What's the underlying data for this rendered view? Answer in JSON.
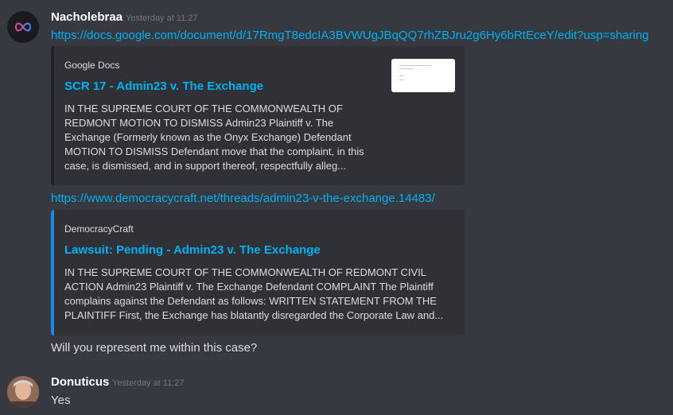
{
  "messages": [
    {
      "username": "Nacholebraa",
      "timestamp": "Yesterday at 11:27",
      "link1": "https://docs.google.com/document/d/17RmgT8edcIA3BVWUgJBqQQ7rhZBJru2g6Hy6bRtEceY/edit?usp=sharing",
      "embed1": {
        "provider": "Google Docs",
        "title": "SCR 17  - Admin23 v. The Exchange",
        "desc_lines": [
          "IN THE SUPREME COURT OF THE COMMONWEALTH OF",
          "REDMONT MOTION TO DISMISS Admin23 Plaintiff v. The",
          "Exchange (Formerly known as the Onyx Exchange) Defendant",
          "MOTION TO DISMISS Defendant move that the complaint, in this",
          "case, is dismissed, and in support thereof, respectfully alleg..."
        ]
      },
      "link2": "https://www.democracycraft.net/threads/admin23-v-the-exchange.14483/",
      "embed2": {
        "provider": "DemocracyCraft",
        "title": "Lawsuit: Pending - Admin23 v. The Exchange",
        "desc_lines": [
          "IN THE SUPREME COURT OF THE COMMONWEALTH OF REDMONT CIVIL",
          "ACTION Admin23 Plaintiff v. The Exchange Defendant COMPLAINT The Plaintiff",
          "complains against the Defendant as follows: WRITTEN STATEMENT FROM THE",
          "PLAINTIFF First, the Exchange has blatantly disregarded the Corporate Law and..."
        ],
        "accent_color": "#1e88e5"
      },
      "text": "Will you represent me within this case?"
    },
    {
      "username": "Donuticus",
      "timestamp": "Yesterday at 11:27",
      "text": "Yes"
    }
  ]
}
